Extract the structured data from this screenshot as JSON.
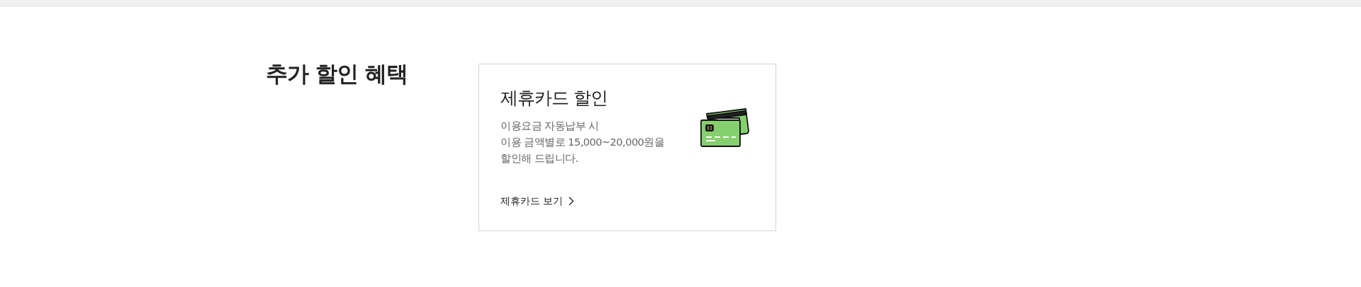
{
  "section": {
    "title": "추가 할인 혜택"
  },
  "card": {
    "title": "제휴카드 할인",
    "description_lines": [
      "이용요금 자동납부 시",
      "이용 금액별로 15,000~20,000원을",
      "할인해 드립니다."
    ],
    "link": "제휴카드 보기"
  }
}
